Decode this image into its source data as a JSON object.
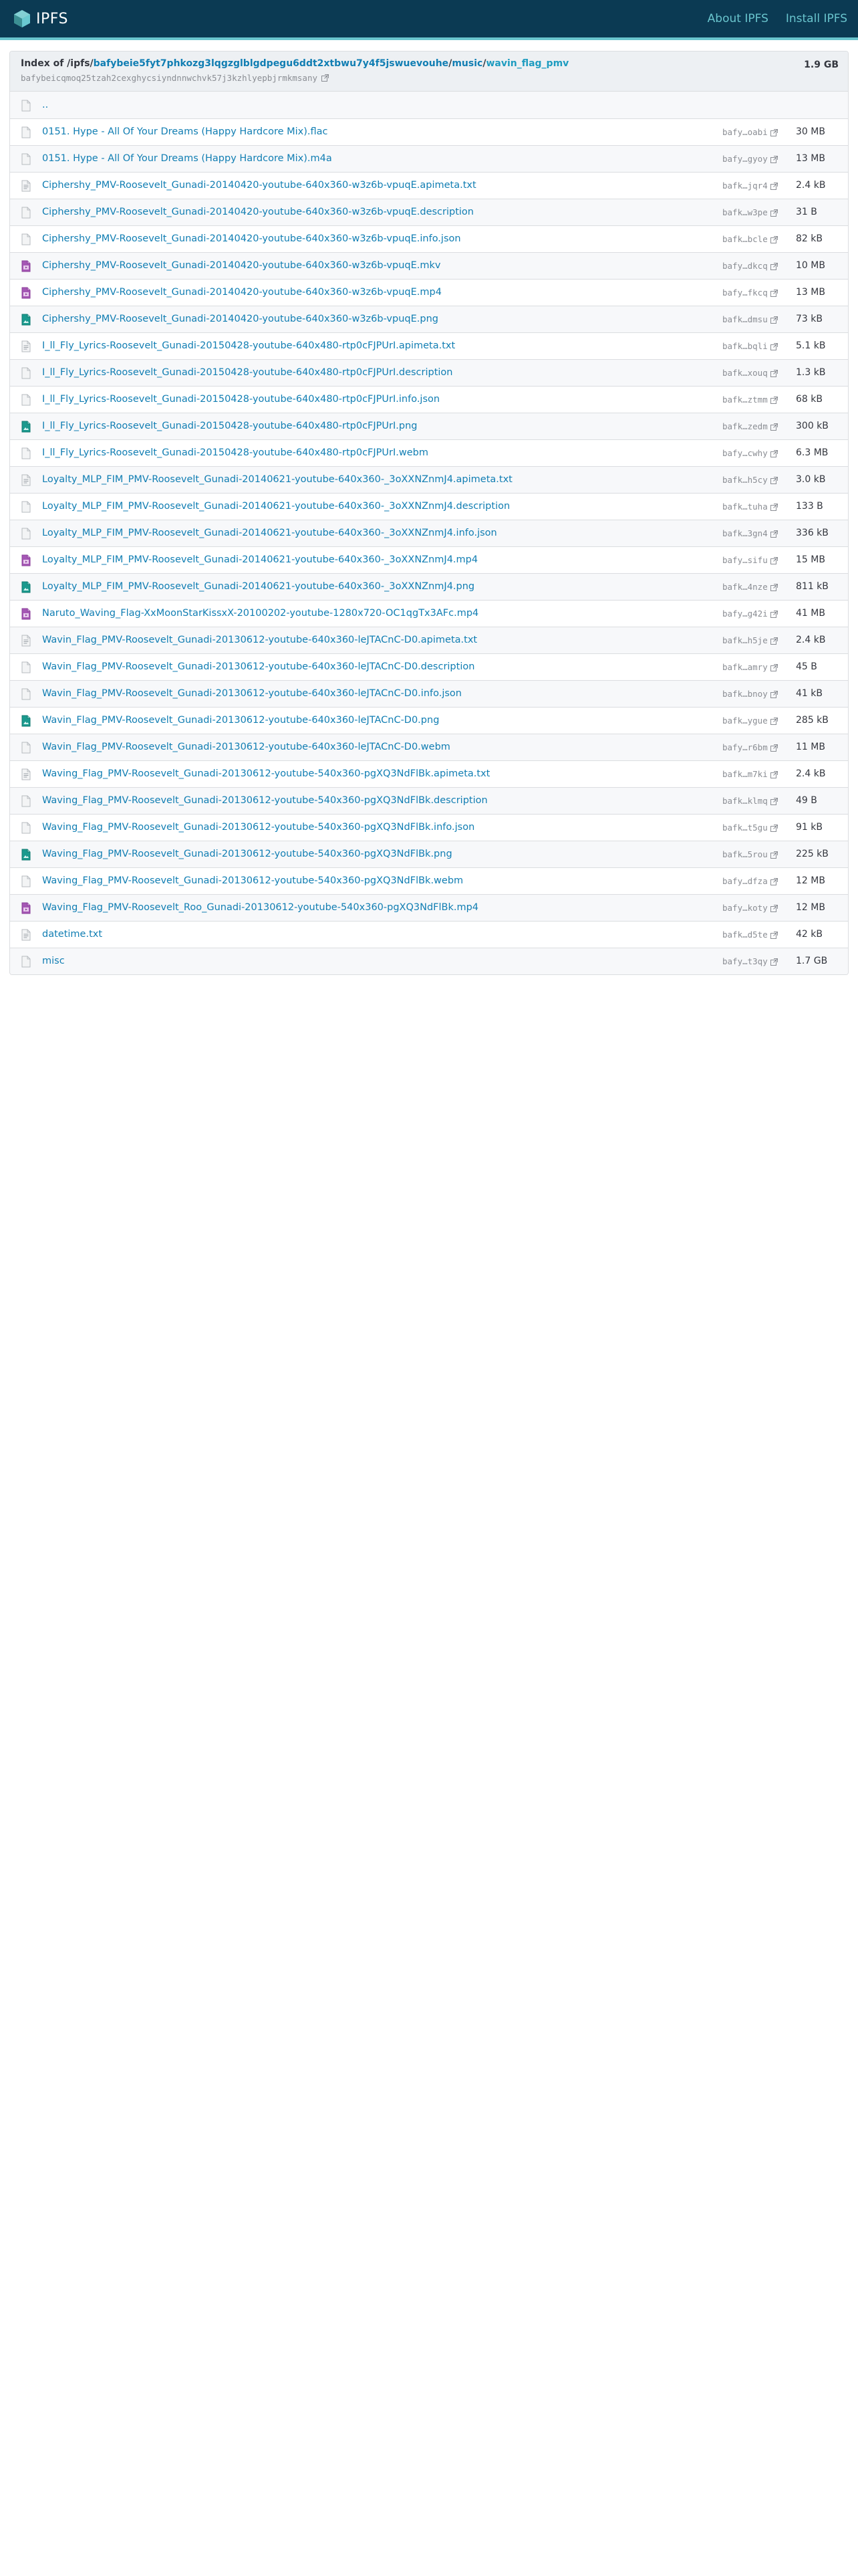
{
  "header": {
    "logo_text": "IPFS",
    "nav": [
      {
        "label": "About IPFS"
      },
      {
        "label": "Install IPFS"
      }
    ]
  },
  "index": {
    "prefix": "Index of /ipfs/",
    "path_root": "bafybeie5fyt7phkozg3lqgzglblgdpegu6ddt2xtbwu7y4f5jswuevouhe",
    "sep1": "/",
    "path_music": "music",
    "sep2": "/",
    "path_current": "wavin_flag_pmv",
    "total_size": "1.9 GB",
    "cid": "bafybeicqmoq25tzah2cexghycsiyndnnwchvk57j3kzhlyepbjrmkmsany"
  },
  "colors": {
    "header_bg": "#0b3a53",
    "header_accent": "#69c4cd",
    "link": "#117eb3",
    "row_alt": "#f7f8fa",
    "border": "#dbdde0"
  },
  "parent_row": {
    "name": "..",
    "icon": "file-icon"
  },
  "rows": [
    {
      "name": "0151. Hype - All Of Your Dreams (Happy Hardcore Mix).flac",
      "cid": "bafy…oabi",
      "size": "30 MB",
      "icon": "file-icon"
    },
    {
      "name": "0151. Hype - All Of Your Dreams (Happy Hardcore Mix).m4a",
      "cid": "bafy…gyoy",
      "size": "13 MB",
      "icon": "file-icon"
    },
    {
      "name": "Ciphershy_PMV-Roosevelt_Gunadi-20140420-youtube-640x360-w3z6b-vpuqE.apimeta.txt",
      "cid": "bafk…jqr4",
      "size": "2.4 kB",
      "icon": "text-file-icon"
    },
    {
      "name": "Ciphershy_PMV-Roosevelt_Gunadi-20140420-youtube-640x360-w3z6b-vpuqE.description",
      "cid": "bafk…w3pe",
      "size": "31 B",
      "icon": "file-icon"
    },
    {
      "name": "Ciphershy_PMV-Roosevelt_Gunadi-20140420-youtube-640x360-w3z6b-vpuqE.info.json",
      "cid": "bafk…bcle",
      "size": "82 kB",
      "icon": "file-icon"
    },
    {
      "name": "Ciphershy_PMV-Roosevelt_Gunadi-20140420-youtube-640x360-w3z6b-vpuqE.mkv",
      "cid": "bafy…dkcq",
      "size": "10 MB",
      "icon": "video-file-icon"
    },
    {
      "name": "Ciphershy_PMV-Roosevelt_Gunadi-20140420-youtube-640x360-w3z6b-vpuqE.mp4",
      "cid": "bafy…fkcq",
      "size": "13 MB",
      "icon": "video-file-icon"
    },
    {
      "name": "Ciphershy_PMV-Roosevelt_Gunadi-20140420-youtube-640x360-w3z6b-vpuqE.png",
      "cid": "bafk…dmsu",
      "size": "73 kB",
      "icon": "image-file-icon"
    },
    {
      "name": "I_ll_Fly_Lyrics-Roosevelt_Gunadi-20150428-youtube-640x480-rtp0cFJPUrI.apimeta.txt",
      "cid": "bafk…bqli",
      "size": "5.1 kB",
      "icon": "text-file-icon"
    },
    {
      "name": "I_ll_Fly_Lyrics-Roosevelt_Gunadi-20150428-youtube-640x480-rtp0cFJPUrI.description",
      "cid": "bafk…xouq",
      "size": "1.3 kB",
      "icon": "file-icon"
    },
    {
      "name": "I_ll_Fly_Lyrics-Roosevelt_Gunadi-20150428-youtube-640x480-rtp0cFJPUrI.info.json",
      "cid": "bafk…ztmm",
      "size": "68 kB",
      "icon": "file-icon"
    },
    {
      "name": "I_ll_Fly_Lyrics-Roosevelt_Gunadi-20150428-youtube-640x480-rtp0cFJPUrI.png",
      "cid": "bafk…zedm",
      "size": "300 kB",
      "icon": "image-file-icon"
    },
    {
      "name": "I_ll_Fly_Lyrics-Roosevelt_Gunadi-20150428-youtube-640x480-rtp0cFJPUrI.webm",
      "cid": "bafy…cwhy",
      "size": "6.3 MB",
      "icon": "file-icon"
    },
    {
      "name": "Loyalty_MLP_FIM_PMV-Roosevelt_Gunadi-20140621-youtube-640x360-_3oXXNZnmJ4.apimeta.txt",
      "cid": "bafk…h5cy",
      "size": "3.0 kB",
      "icon": "text-file-icon"
    },
    {
      "name": "Loyalty_MLP_FIM_PMV-Roosevelt_Gunadi-20140621-youtube-640x360-_3oXXNZnmJ4.description",
      "cid": "bafk…tuha",
      "size": "133 B",
      "icon": "file-icon"
    },
    {
      "name": "Loyalty_MLP_FIM_PMV-Roosevelt_Gunadi-20140621-youtube-640x360-_3oXXNZnmJ4.info.json",
      "cid": "bafk…3gn4",
      "size": "336 kB",
      "icon": "file-icon"
    },
    {
      "name": "Loyalty_MLP_FIM_PMV-Roosevelt_Gunadi-20140621-youtube-640x360-_3oXXNZnmJ4.mp4",
      "cid": "bafy…sifu",
      "size": "15 MB",
      "icon": "video-file-icon"
    },
    {
      "name": "Loyalty_MLP_FIM_PMV-Roosevelt_Gunadi-20140621-youtube-640x360-_3oXXNZnmJ4.png",
      "cid": "bafk…4nze",
      "size": "811 kB",
      "icon": "image-file-icon"
    },
    {
      "name": "Naruto_Waving_Flag-XxMoonStarKissxX-20100202-youtube-1280x720-OC1qgTx3AFc.mp4",
      "cid": "bafy…g42i",
      "size": "41 MB",
      "icon": "video-file-icon"
    },
    {
      "name": "Wavin_Flag_PMV-Roosevelt_Gunadi-20130612-youtube-640x360-leJTACnC-D0.apimeta.txt",
      "cid": "bafk…h5je",
      "size": "2.4 kB",
      "icon": "text-file-icon"
    },
    {
      "name": "Wavin_Flag_PMV-Roosevelt_Gunadi-20130612-youtube-640x360-leJTACnC-D0.description",
      "cid": "bafk…amry",
      "size": "45 B",
      "icon": "file-icon"
    },
    {
      "name": "Wavin_Flag_PMV-Roosevelt_Gunadi-20130612-youtube-640x360-leJTACnC-D0.info.json",
      "cid": "bafk…bnoy",
      "size": "41 kB",
      "icon": "file-icon"
    },
    {
      "name": "Wavin_Flag_PMV-Roosevelt_Gunadi-20130612-youtube-640x360-leJTACnC-D0.png",
      "cid": "bafk…ygue",
      "size": "285 kB",
      "icon": "image-file-icon"
    },
    {
      "name": "Wavin_Flag_PMV-Roosevelt_Gunadi-20130612-youtube-640x360-leJTACnC-D0.webm",
      "cid": "bafy…r6bm",
      "size": "11 MB",
      "icon": "file-icon"
    },
    {
      "name": "Waving_Flag_PMV-Roosevelt_Gunadi-20130612-youtube-540x360-pgXQ3NdFlBk.apimeta.txt",
      "cid": "bafk…m7ki",
      "size": "2.4 kB",
      "icon": "text-file-icon"
    },
    {
      "name": "Waving_Flag_PMV-Roosevelt_Gunadi-20130612-youtube-540x360-pgXQ3NdFlBk.description",
      "cid": "bafk…klmq",
      "size": "49 B",
      "icon": "file-icon"
    },
    {
      "name": "Waving_Flag_PMV-Roosevelt_Gunadi-20130612-youtube-540x360-pgXQ3NdFlBk.info.json",
      "cid": "bafk…t5gu",
      "size": "91 kB",
      "icon": "file-icon"
    },
    {
      "name": "Waving_Flag_PMV-Roosevelt_Gunadi-20130612-youtube-540x360-pgXQ3NdFlBk.png",
      "cid": "bafk…5rou",
      "size": "225 kB",
      "icon": "image-file-icon"
    },
    {
      "name": "Waving_Flag_PMV-Roosevelt_Gunadi-20130612-youtube-540x360-pgXQ3NdFlBk.webm",
      "cid": "bafy…dfza",
      "size": "12 MB",
      "icon": "file-icon"
    },
    {
      "name": "Waving_Flag_PMV-Roosevelt_Roo_Gunadi-20130612-youtube-540x360-pgXQ3NdFlBk.mp4",
      "cid": "bafy…koty",
      "size": "12 MB",
      "icon": "video-file-icon"
    },
    {
      "name": "datetime.txt",
      "cid": "bafk…d5te",
      "size": "42 kB",
      "icon": "text-file-icon"
    },
    {
      "name": "misc",
      "cid": "bafy…t3qy",
      "size": "1.7 GB",
      "icon": "file-icon"
    }
  ]
}
